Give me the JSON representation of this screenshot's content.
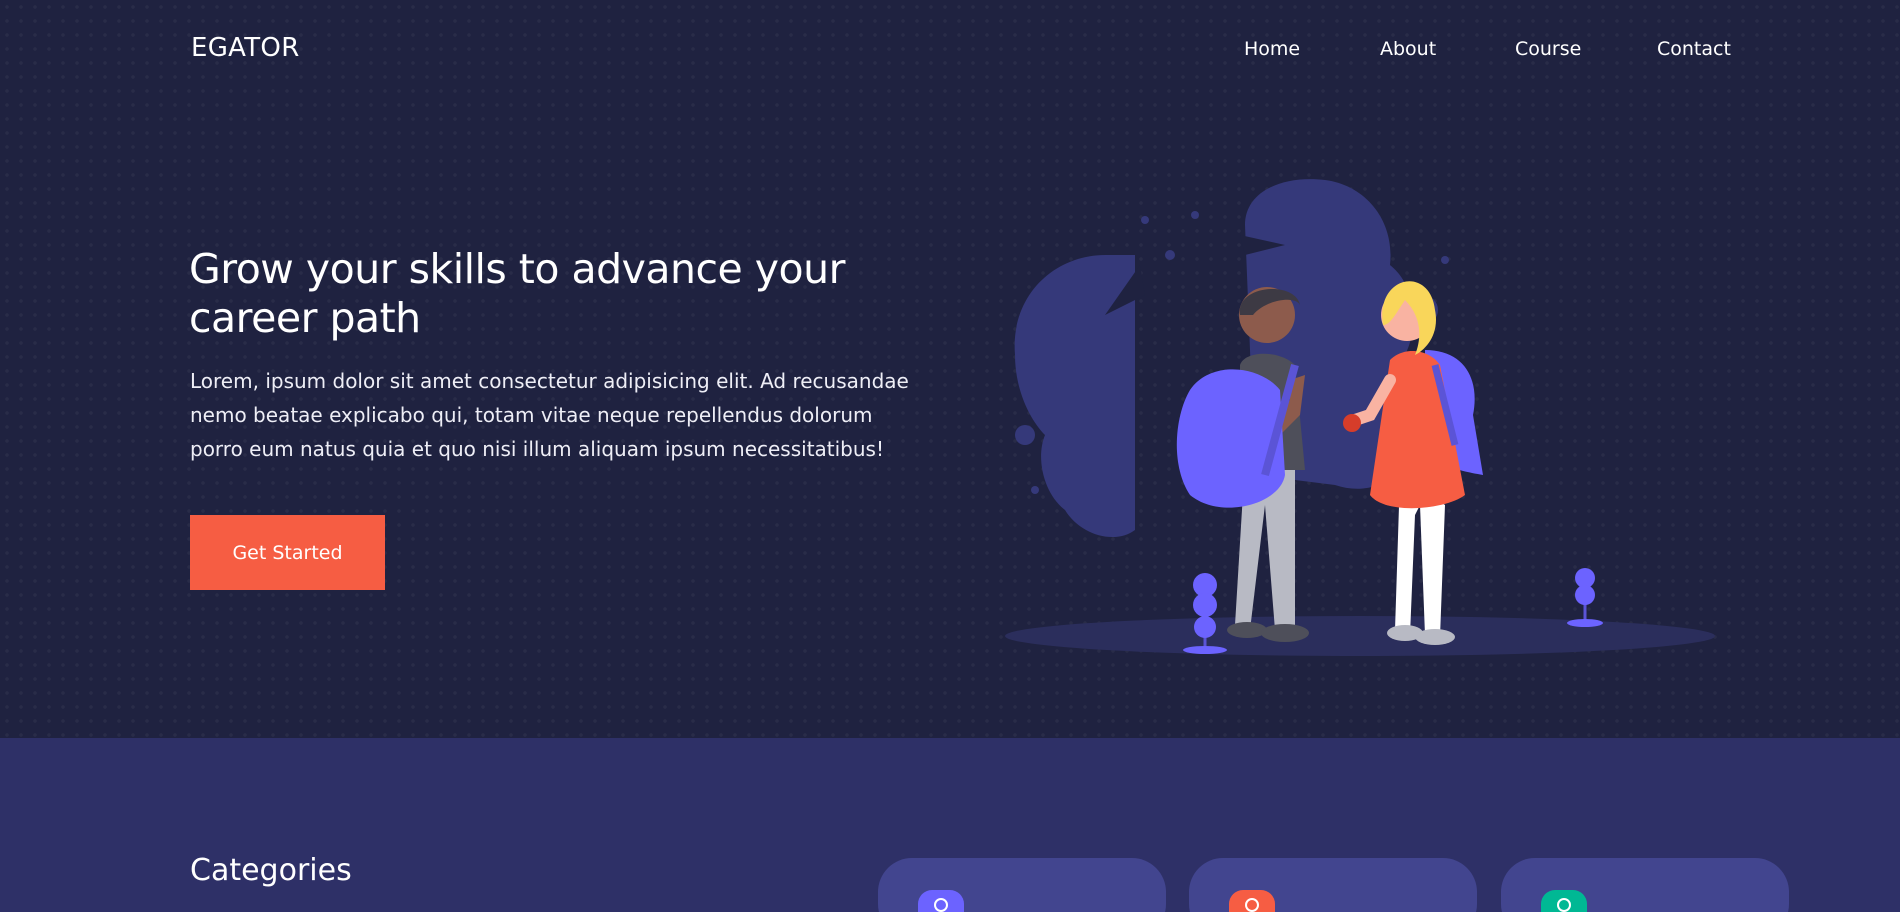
{
  "brand": {
    "name": "EGATOR"
  },
  "nav": {
    "items": [
      {
        "label": "Home"
      },
      {
        "label": "About"
      },
      {
        "label": "Course"
      },
      {
        "label": "Contact"
      }
    ]
  },
  "hero": {
    "title": "Grow your skills to advance your career path",
    "text": "Lorem, ipsum dolor sit amet consectetur adipisicing elit. Ad recusandae nemo beatae explicabo qui, totam vitae neque repellendus dolorum porro eum natus quia et quo nisi illum aliquam ipsum necessitatibus!",
    "cta_label": "Get Started"
  },
  "categories": {
    "title": "Categories",
    "cards": [
      {
        "icon": "category-icon",
        "color": "#6c63ff"
      },
      {
        "icon": "category-icon",
        "color": "#f65d43"
      },
      {
        "icon": "category-icon",
        "color": "#00b894"
      }
    ]
  },
  "colors": {
    "hero_bg": "#1f2240",
    "section_bg": "#2e3067",
    "accent": "#f65d43",
    "purple": "#6c63ff",
    "card_bg": "#42458f"
  }
}
